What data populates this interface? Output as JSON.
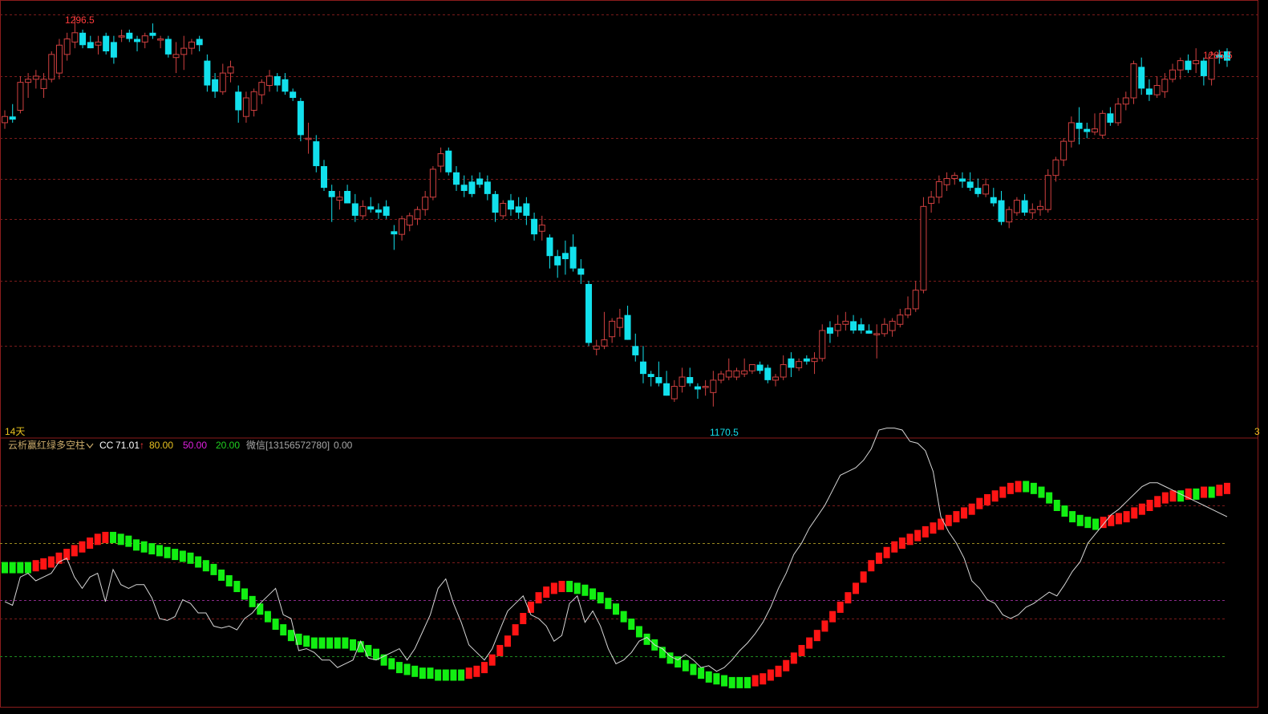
{
  "colors": {
    "up": "#ff3b3b",
    "up_candle": "#d04040",
    "down": "#12e0ec",
    "grid_red": "#7a1b1b",
    "frame": "#8b1c1c",
    "bar_red": "#ff1414",
    "bar_green": "#12ef12",
    "line_white": "#d6d6d6",
    "legend_title": "#c8a96a",
    "legend_cc": "#ffffff",
    "legend_80": "#e8c220",
    "legend_50": "#e020e0",
    "legend_20": "#20d020",
    "legend_wechat": "#a8a8a8"
  },
  "price_panel": {
    "high_label": "1296.5",
    "low_label": "1170.5",
    "right_high_label": "1285.5",
    "left_marker": "14天",
    "right_marker": "3"
  },
  "indicator_panel": {
    "name": "云析赢红绿多空柱",
    "cc_label": "CC",
    "cc_value": "71.01",
    "cc_arrow": "↑",
    "level_80": "80.00",
    "level_50": "50.00",
    "level_20": "20.00",
    "wechat_label": "微信[13156572780]",
    "wechat_value": "0.00"
  },
  "chart_data": [
    {
      "type": "candlestick",
      "grid": true,
      "ylim": [
        1165,
        1300
      ],
      "candles": [
        [
          1262,
          1266,
          1260,
          1264
        ],
        [
          1264,
          1268,
          1262,
          1263
        ],
        [
          1266,
          1277,
          1265,
          1275
        ],
        [
          1275,
          1278,
          1270,
          1276
        ],
        [
          1276,
          1279,
          1273,
          1277
        ],
        [
          1273,
          1278,
          1270,
          1276
        ],
        [
          1276,
          1285,
          1275,
          1284
        ],
        [
          1278,
          1289,
          1276,
          1287
        ],
        [
          1284,
          1291,
          1282,
          1289
        ],
        [
          1288,
          1296.5,
          1286,
          1291
        ],
        [
          1291,
          1292,
          1286,
          1287
        ],
        [
          1288,
          1290,
          1286,
          1286
        ],
        [
          1287,
          1290,
          1284,
          1288
        ],
        [
          1290,
          1291,
          1284,
          1285
        ],
        [
          1288,
          1290,
          1281,
          1283
        ],
        [
          1290,
          1292,
          1288,
          1290
        ],
        [
          1291,
          1292,
          1288,
          1289
        ],
        [
          1289,
          1290,
          1285,
          1288
        ],
        [
          1288,
          1291,
          1286,
          1290
        ],
        [
          1291,
          1294,
          1289,
          1290
        ],
        [
          1289,
          1290,
          1286,
          1289
        ],
        [
          1289,
          1290,
          1283,
          1284
        ],
        [
          1283,
          1288,
          1278,
          1284
        ],
        [
          1284,
          1290,
          1279,
          1286
        ],
        [
          1286,
          1289,
          1284,
          1288
        ],
        [
          1289,
          1290,
          1285,
          1287
        ],
        [
          1282,
          1284,
          1272,
          1274
        ],
        [
          1276,
          1278,
          1270,
          1272
        ],
        [
          1272,
          1281,
          1271,
          1278
        ],
        [
          1278,
          1282,
          1275,
          1280
        ],
        [
          1272,
          1274,
          1262,
          1266
        ],
        [
          1264,
          1272,
          1262,
          1270
        ],
        [
          1266,
          1273,
          1264,
          1272
        ],
        [
          1271,
          1276,
          1268,
          1275
        ],
        [
          1274,
          1279,
          1272,
          1277
        ],
        [
          1277,
          1278,
          1272,
          1274
        ],
        [
          1276,
          1278,
          1271,
          1272
        ],
        [
          1272,
          1273,
          1269,
          1270
        ],
        [
          1269,
          1270,
          1256,
          1258
        ],
        [
          1257,
          1262,
          1252,
          1257
        ],
        [
          1256,
          1258,
          1246,
          1248
        ],
        [
          1248,
          1250,
          1240,
          1241
        ],
        [
          1240,
          1242,
          1230,
          1238
        ],
        [
          1237,
          1240,
          1234,
          1238
        ],
        [
          1240,
          1242,
          1236,
          1236
        ],
        [
          1236,
          1239,
          1230,
          1232
        ],
        [
          1232,
          1237,
          1231,
          1235
        ],
        [
          1235,
          1238,
          1233,
          1234
        ],
        [
          1234,
          1236,
          1231,
          1233
        ],
        [
          1235,
          1237,
          1231,
          1232
        ],
        [
          1227,
          1229,
          1221,
          1226
        ],
        [
          1226,
          1232,
          1224,
          1231
        ],
        [
          1229,
          1233,
          1227,
          1232
        ],
        [
          1231,
          1235,
          1229,
          1234
        ],
        [
          1234,
          1240,
          1232,
          1238
        ],
        [
          1238,
          1248,
          1237,
          1247
        ],
        [
          1248,
          1254,
          1246,
          1252
        ],
        [
          1253,
          1254,
          1245,
          1246
        ],
        [
          1246,
          1248,
          1240,
          1242
        ],
        [
          1242,
          1245,
          1238,
          1240
        ],
        [
          1243,
          1245,
          1238,
          1239
        ],
        [
          1244,
          1246,
          1241,
          1242
        ],
        [
          1243,
          1245,
          1237,
          1239
        ],
        [
          1239,
          1240,
          1230,
          1233
        ],
        [
          1232,
          1237,
          1231,
          1236
        ],
        [
          1237,
          1239,
          1232,
          1234
        ],
        [
          1235,
          1238,
          1231,
          1233
        ],
        [
          1236,
          1238,
          1229,
          1232
        ],
        [
          1231,
          1233,
          1224,
          1226
        ],
        [
          1227,
          1232,
          1224,
          1229
        ],
        [
          1225,
          1226,
          1215,
          1219
        ],
        [
          1219,
          1221,
          1212,
          1216
        ],
        [
          1220,
          1224,
          1213,
          1218
        ],
        [
          1222,
          1226,
          1214,
          1215
        ],
        [
          1215,
          1218,
          1210,
          1213
        ],
        [
          1210,
          1211,
          1190,
          1191
        ],
        [
          1189,
          1192,
          1187,
          1190
        ],
        [
          1190,
          1201,
          1189,
          1192
        ],
        [
          1193,
          1199,
          1191,
          1198
        ],
        [
          1196,
          1202,
          1193,
          1199
        ],
        [
          1200,
          1203,
          1192,
          1192
        ],
        [
          1190,
          1194,
          1185,
          1187
        ],
        [
          1185,
          1190,
          1178,
          1181
        ],
        [
          1181,
          1182,
          1177,
          1180
        ],
        [
          1180,
          1185,
          1177,
          1178
        ],
        [
          1178,
          1182,
          1174,
          1174
        ],
        [
          1173,
          1179,
          1172,
          1177
        ],
        [
          1177,
          1183,
          1175,
          1180
        ],
        [
          1180,
          1183,
          1177,
          1178
        ],
        [
          1177,
          1178,
          1173,
          1176
        ],
        [
          1177,
          1179,
          1174,
          1177
        ],
        [
          1175,
          1182,
          1170.5,
          1179
        ],
        [
          1179,
          1182,
          1178,
          1181
        ],
        [
          1180,
          1186,
          1179,
          1182
        ],
        [
          1180,
          1183,
          1179,
          1182
        ],
        [
          1181,
          1186,
          1180,
          1182
        ],
        [
          1182,
          1184,
          1181,
          1184
        ],
        [
          1184,
          1185,
          1181,
          1182
        ],
        [
          1183,
          1184,
          1178,
          1179
        ],
        [
          1179,
          1181,
          1177,
          1180
        ],
        [
          1180,
          1187,
          1179,
          1184
        ],
        [
          1186,
          1188,
          1180,
          1183
        ],
        [
          1183,
          1186,
          1182,
          1185
        ],
        [
          1186,
          1187,
          1184,
          1185
        ],
        [
          1185,
          1188,
          1181,
          1186
        ],
        [
          1186,
          1197,
          1185,
          1195
        ],
        [
          1196,
          1198,
          1191,
          1194
        ],
        [
          1195,
          1200,
          1193,
          1197
        ],
        [
          1197,
          1201,
          1195,
          1198
        ],
        [
          1198,
          1200,
          1194,
          1195
        ],
        [
          1197,
          1199,
          1194,
          1195
        ],
        [
          1195,
          1197,
          1194,
          1194
        ],
        [
          1194,
          1197,
          1186,
          1194
        ],
        [
          1194,
          1199,
          1193,
          1197
        ],
        [
          1195,
          1199,
          1193,
          1198
        ],
        [
          1197,
          1202,
          1196,
          1200
        ],
        [
          1200,
          1206,
          1199,
          1202
        ],
        [
          1202,
          1211,
          1201,
          1208
        ],
        [
          1208,
          1238,
          1207,
          1235
        ],
        [
          1236,
          1240,
          1233,
          1238
        ],
        [
          1238,
          1245,
          1236,
          1243
        ],
        [
          1242,
          1246,
          1240,
          1244
        ],
        [
          1244,
          1246,
          1242,
          1245
        ],
        [
          1244,
          1246,
          1241,
          1243
        ],
        [
          1243,
          1246,
          1240,
          1241
        ],
        [
          1241,
          1244,
          1238,
          1239
        ],
        [
          1239,
          1244,
          1238,
          1242
        ],
        [
          1238,
          1241,
          1235,
          1236
        ],
        [
          1237,
          1240,
          1229,
          1230
        ],
        [
          1230,
          1235,
          1228,
          1234
        ],
        [
          1233,
          1238,
          1232,
          1237
        ],
        [
          1237,
          1239,
          1232,
          1233
        ],
        [
          1233,
          1236,
          1231,
          1234
        ],
        [
          1234,
          1237,
          1232,
          1235
        ],
        [
          1234,
          1247,
          1233,
          1245
        ],
        [
          1245,
          1251,
          1243,
          1250
        ],
        [
          1250,
          1257,
          1248,
          1256
        ],
        [
          1256,
          1264,
          1254,
          1262
        ],
        [
          1262,
          1267,
          1255,
          1260
        ],
        [
          1260,
          1262,
          1257,
          1259
        ],
        [
          1259,
          1265,
          1258,
          1260
        ],
        [
          1258,
          1266,
          1257,
          1265
        ],
        [
          1265,
          1267,
          1261,
          1262
        ],
        [
          1262,
          1270,
          1261,
          1268
        ],
        [
          1268,
          1272,
          1266,
          1270
        ],
        [
          1270,
          1282,
          1268,
          1281
        ],
        [
          1280,
          1283,
          1271,
          1273
        ],
        [
          1273,
          1276,
          1269,
          1271
        ],
        [
          1271,
          1277,
          1270,
          1274
        ],
        [
          1272,
          1278,
          1270,
          1276
        ],
        [
          1276,
          1281,
          1275,
          1279
        ],
        [
          1279,
          1283,
          1276,
          1282
        ],
        [
          1282,
          1284,
          1278,
          1279
        ],
        [
          1281,
          1286,
          1278,
          1282
        ],
        [
          1282,
          1283,
          1274,
          1277
        ],
        [
          1276,
          1285,
          1274,
          1284
        ],
        [
          1284,
          1285.5,
          1281,
          1283
        ],
        [
          1285,
          1286,
          1280,
          1282
        ]
      ],
      "labels": {
        "high": "1296.5",
        "low": "1170.5",
        "right_high": "1285.5"
      }
    },
    {
      "type": "bar",
      "name": "云析赢红绿多空柱",
      "ylim": [
        0,
        100
      ],
      "levels": [
        80,
        50,
        20
      ],
      "series": [
        {
          "values": [
            67,
            67,
            67,
            67,
            68,
            69,
            70,
            72,
            74,
            76,
            78,
            80,
            82,
            83,
            83,
            82,
            81,
            79,
            78,
            77,
            76,
            75,
            74,
            73,
            72,
            70,
            68,
            66,
            63,
            60,
            57,
            53,
            49,
            45,
            41,
            37,
            34,
            31,
            29,
            28,
            27,
            27,
            27,
            27,
            27,
            26,
            25,
            23,
            21,
            18,
            16,
            14,
            13,
            12,
            11,
            11,
            10,
            10,
            10,
            10,
            11,
            12,
            14,
            18,
            23,
            28,
            34,
            40,
            46,
            51,
            54,
            56,
            57,
            57,
            56,
            55,
            53,
            51,
            48,
            45,
            41,
            37,
            33,
            29,
            26,
            22,
            19,
            17,
            15,
            13,
            11,
            9,
            8,
            7,
            6,
            6,
            6,
            7,
            8,
            10,
            12,
            15,
            19,
            23,
            27,
            31,
            36,
            41,
            46,
            51,
            56,
            62,
            68,
            72,
            75,
            78,
            80,
            82,
            84,
            86,
            88,
            90,
            92,
            94,
            96,
            98,
            101,
            103,
            105,
            107,
            109,
            110,
            110,
            109,
            107,
            104,
            100,
            97,
            94,
            92,
            91,
            90,
            91,
            92,
            93,
            94,
            96,
            98,
            100,
            102,
            104,
            105,
            105,
            106,
            106,
            107,
            107,
            108,
            109
          ]
        },
        {
          "values": [
            49,
            47,
            62,
            64,
            60,
            62,
            64,
            70,
            72,
            62,
            56,
            62,
            64,
            49,
            66,
            58,
            56,
            58,
            58,
            51,
            40,
            39,
            41,
            50,
            48,
            43,
            43,
            36,
            35,
            36,
            34,
            40,
            43,
            48,
            52,
            56,
            42,
            40,
            23,
            24,
            22,
            18,
            18,
            14,
            16,
            18,
            28,
            19,
            18,
            20,
            22,
            24,
            18,
            24,
            33,
            42,
            56,
            61,
            48,
            38,
            26,
            22,
            18,
            24,
            34,
            44,
            48,
            52,
            42,
            40,
            36,
            28,
            31,
            48,
            52,
            38,
            44,
            36,
            24,
            16,
            18,
            22,
            28,
            30,
            26,
            24,
            20,
            18,
            21,
            18,
            14,
            15,
            12,
            14,
            18,
            23,
            27,
            32,
            38,
            46,
            56,
            64,
            74,
            80,
            88,
            94,
            100,
            108,
            116,
            118,
            120,
            124,
            130,
            140,
            141,
            141,
            140,
            134,
            133,
            129,
            118,
            94,
            86,
            80,
            72,
            60,
            56,
            50,
            48,
            42,
            40,
            42,
            46,
            48,
            51,
            54,
            52,
            58,
            65,
            70,
            80,
            85,
            90,
            95,
            98,
            102,
            106,
            110,
            112,
            112,
            110,
            108,
            106,
            104,
            102,
            100,
            98,
            96,
            94
          ]
        }
      ]
    }
  ]
}
